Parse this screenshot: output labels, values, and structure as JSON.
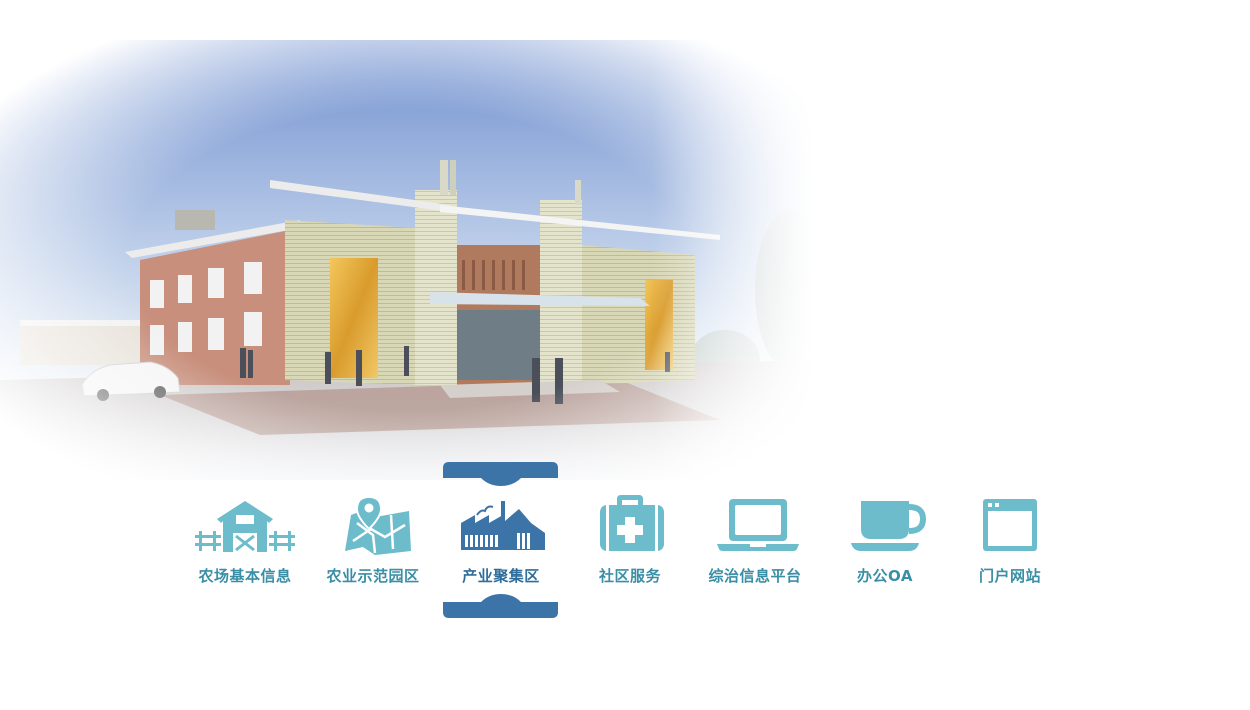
{
  "nav": {
    "items": [
      {
        "label": "农场基本信息",
        "icon": "barn-icon"
      },
      {
        "label": "农业示范园区",
        "icon": "map-pin-icon"
      },
      {
        "label": "产业聚集区",
        "icon": "factory-icon",
        "active": true
      },
      {
        "label": "社区服务",
        "icon": "first-aid-kit-icon"
      },
      {
        "label": "综治信息平台",
        "icon": "laptop-icon"
      },
      {
        "label": "办公OA",
        "icon": "coffee-cup-icon"
      },
      {
        "label": "门户网站",
        "icon": "browser-window-icon"
      }
    ]
  },
  "colors": {
    "icon": "#6cbccc",
    "label": "#3a8ea5",
    "active": "#3d74a8"
  }
}
